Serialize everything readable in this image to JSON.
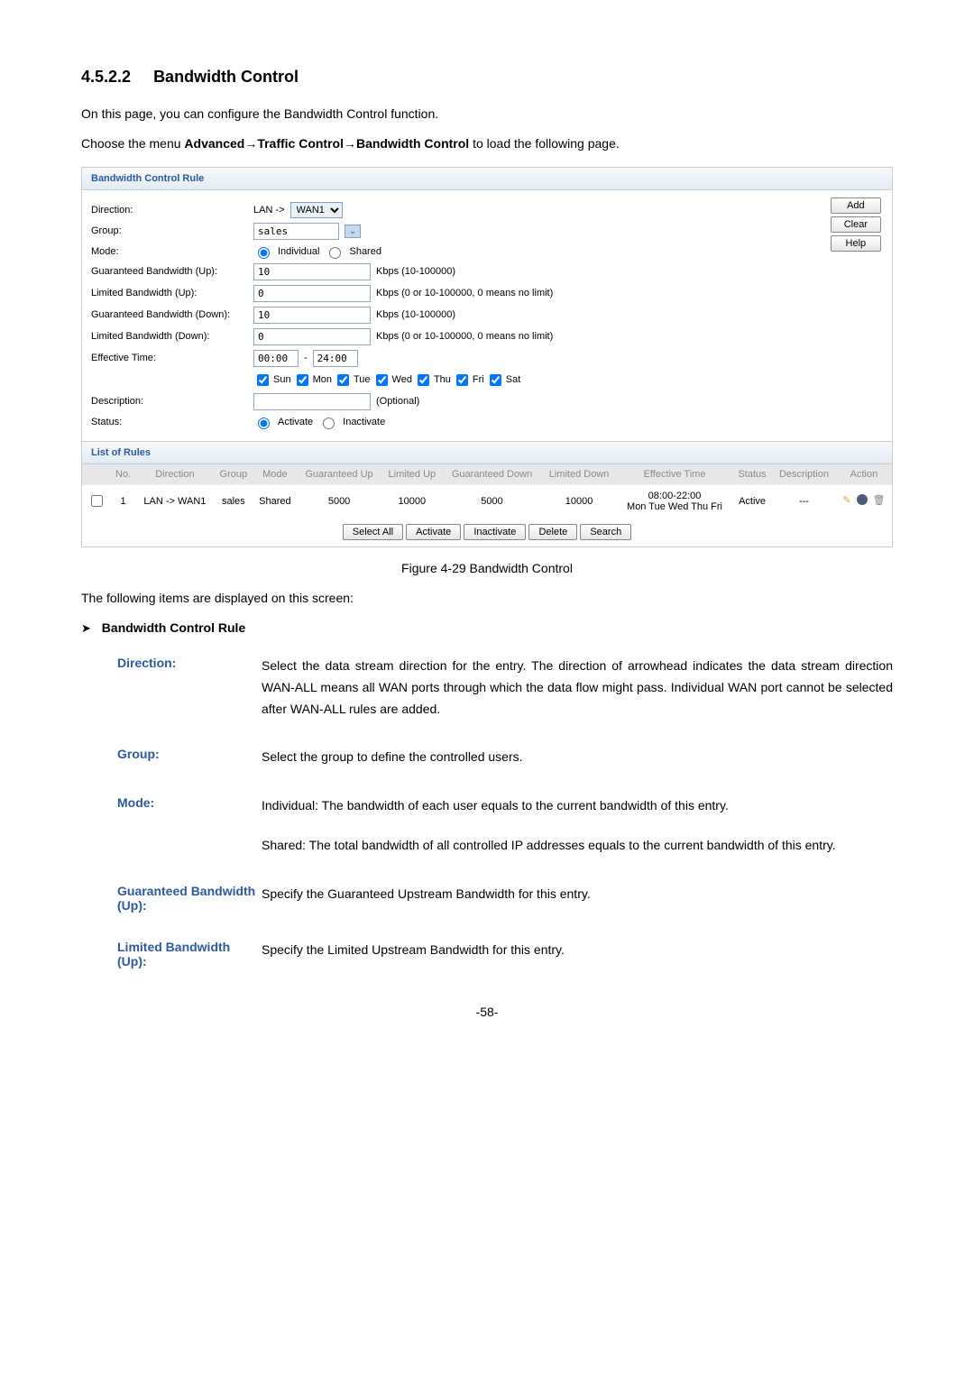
{
  "heading_num": "4.5.2.2",
  "heading_title": "Bandwidth Control",
  "intro1": "On this page, you can configure the Bandwidth Control function.",
  "intro2_pre": "Choose the menu ",
  "intro2_bold": "Advanced→Traffic Control→Bandwidth Control",
  "intro2_post": " to load the following page.",
  "panel": {
    "title": "Bandwidth Control Rule",
    "direction_label": "Direction:",
    "direction_lan": "LAN ->",
    "direction_wan": "WAN1",
    "group_label": "Group:",
    "group_value": "sales",
    "mode_label": "Mode:",
    "mode_individual": "Individual",
    "mode_shared": "Shared",
    "g_up_label": "Guaranteed Bandwidth (Up):",
    "g_up_value": "10",
    "g_up_hint": "Kbps (10-100000)",
    "l_up_label": "Limited Bandwidth (Up):",
    "l_up_value": "0",
    "l_up_hint": "Kbps (0 or 10-100000, 0 means no limit)",
    "g_down_label": "Guaranteed Bandwidth (Down):",
    "g_down_value": "10",
    "g_down_hint": "Kbps (10-100000)",
    "l_down_label": "Limited Bandwidth (Down):",
    "l_down_value": "0",
    "l_down_hint": "Kbps (0 or 10-100000, 0 means no limit)",
    "eff_time_label": "Effective Time:",
    "eff_time_from": "00:00",
    "eff_time_to": "24:00",
    "days": [
      "Sun",
      "Mon",
      "Tue",
      "Wed",
      "Thu",
      "Fri",
      "Sat"
    ],
    "desc_label": "Description:",
    "desc_hint": "(Optional)",
    "status_label": "Status:",
    "status_activate": "Activate",
    "status_inactivate": "Inactivate",
    "btn_add": "Add",
    "btn_clear": "Clear",
    "btn_help": "Help",
    "list_title": "List of Rules",
    "headers": {
      "no": "No.",
      "direction": "Direction",
      "group": "Group",
      "mode": "Mode",
      "gup": "Guaranteed Up",
      "lup": "Limited Up",
      "gdown": "Guaranteed Down",
      "ldown": "Limited Down",
      "eff": "Effective Time",
      "status": "Status",
      "desc": "Description",
      "action": "Action"
    },
    "row": {
      "no": "1",
      "direction": "LAN -> WAN1",
      "group": "sales",
      "mode": "Shared",
      "gup": "5000",
      "lup": "10000",
      "gdown": "5000",
      "ldown": "10000",
      "eff_time": "08:00-22:00",
      "eff_days": "Mon Tue Wed Thu Fri",
      "status": "Active",
      "desc": "---"
    },
    "tbtn_selectall": "Select All",
    "tbtn_activate": "Activate",
    "tbtn_inactivate": "Inactivate",
    "tbtn_delete": "Delete",
    "tbtn_search": "Search"
  },
  "figure_caption": "Figure 4-29 Bandwidth Control",
  "following_items": "The following items are displayed on this screen:",
  "sub_title": "Bandwidth Control Rule",
  "terms": {
    "direction_label": "Direction:",
    "direction_desc": "Select the data stream direction for the entry. The direction of arrowhead indicates the data stream direction WAN-ALL means all WAN ports through which the data flow might pass. Individual WAN port cannot be selected after WAN-ALL rules are added.",
    "group_label": "Group:",
    "group_desc": "Select the group to define the controlled users.",
    "mode_label": "Mode:",
    "mode_desc1": "Individual: The bandwidth of each user equals to the current bandwidth of this entry.",
    "mode_desc2": "Shared: The total bandwidth of all controlled IP addresses equals to the current bandwidth of this entry.",
    "gup_label": "Guaranteed Bandwidth (Up):",
    "gup_desc": "Specify the Guaranteed Upstream Bandwidth for this entry.",
    "lup_label": "Limited Bandwidth (Up):",
    "lup_desc": "Specify the Limited Upstream Bandwidth for this entry."
  },
  "page_num": "-58-"
}
